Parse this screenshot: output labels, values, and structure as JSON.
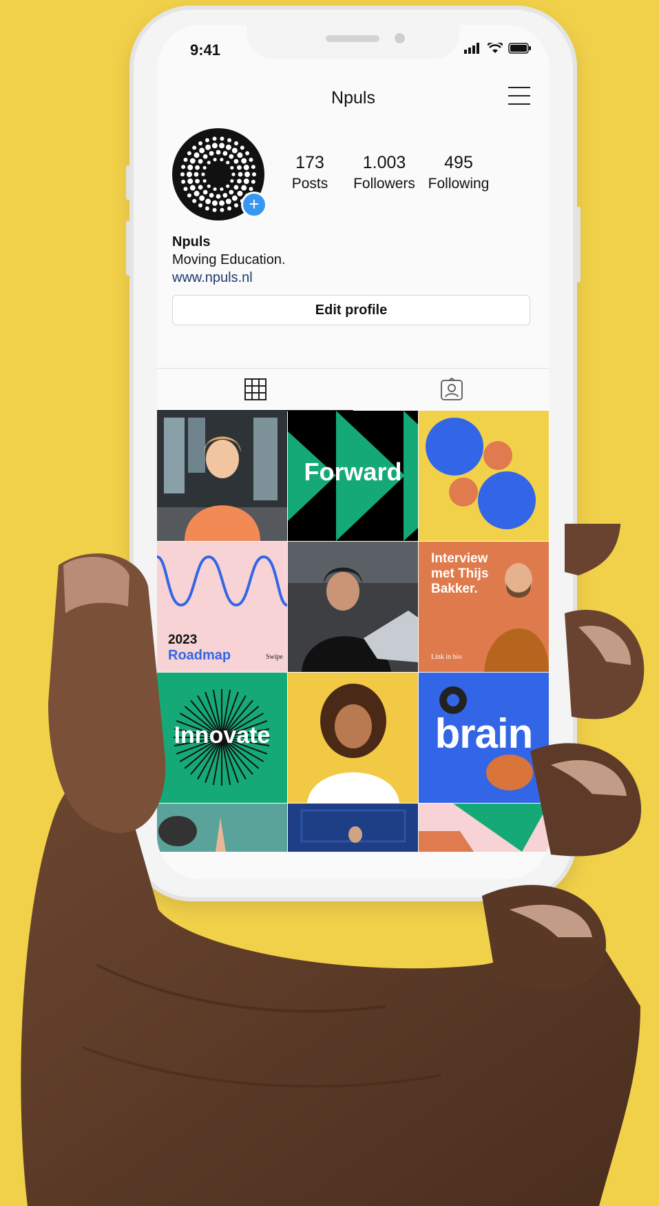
{
  "colors": {
    "background": "#f2d14a",
    "link": "#1c3a6e",
    "accent_blue": "#3366e6",
    "accent_green": "#15a978",
    "accent_orange": "#e07a4f"
  },
  "status_bar": {
    "time": "9:41"
  },
  "header": {
    "title": "Npuls",
    "menu_icon": "hamburger-menu-icon"
  },
  "profile": {
    "avatar_icon": "dotted-ring-logo-icon",
    "add_icon": "plus-icon",
    "stats": [
      {
        "value": "173",
        "label": "Posts"
      },
      {
        "value": "1.003",
        "label": "Followers"
      },
      {
        "value": "495",
        "label": "Following"
      }
    ],
    "name": "Npuls",
    "bio": "Moving Education.",
    "website": "www.npuls.nl",
    "edit_button": "Edit profile"
  },
  "tabs": [
    {
      "icon": "grid-icon",
      "active": true
    },
    {
      "icon": "tagged-person-icon",
      "active": false
    }
  ],
  "posts": [
    {
      "kind": "photo",
      "subject": "girl-orange-sweater"
    },
    {
      "kind": "graphic",
      "text": "Forward"
    },
    {
      "kind": "graphic",
      "subject": "circles"
    },
    {
      "kind": "graphic",
      "year": "2023",
      "title": "Roadmap",
      "note": "Swipe"
    },
    {
      "kind": "photo",
      "subject": "student-laptop"
    },
    {
      "kind": "graphic",
      "title": "Interview met Thijs Bakker.",
      "note": "Link in bio"
    },
    {
      "kind": "graphic",
      "text": "Innovate"
    },
    {
      "kind": "photo",
      "subject": "smiling-woman"
    },
    {
      "kind": "graphic",
      "text": "brain"
    }
  ]
}
